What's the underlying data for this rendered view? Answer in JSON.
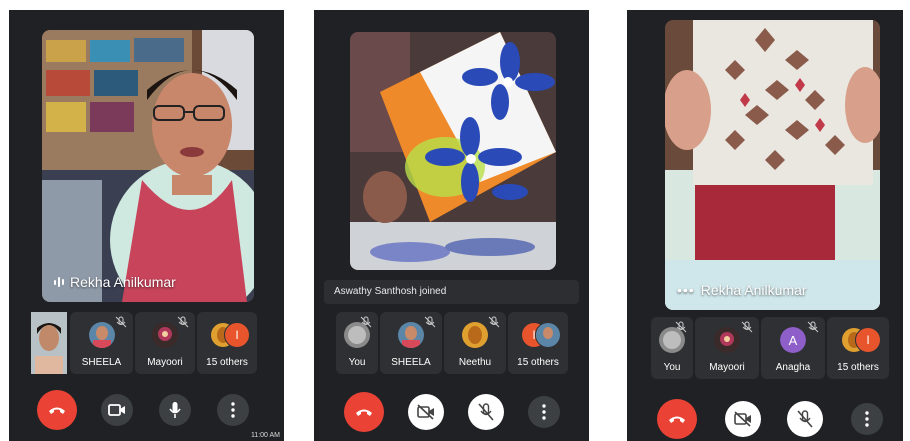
{
  "screens": [
    {
      "speaker_name": "Rekha Anilkumar",
      "tiles": [
        {
          "label": ""
        },
        {
          "label": "SHEELA"
        },
        {
          "label": "Mayoori"
        },
        {
          "label": "15 others",
          "badge": "I"
        }
      ],
      "status_time": "11:00 AM"
    },
    {
      "toast": "Aswathy Santhosh joined",
      "tiles": [
        {
          "label": "You"
        },
        {
          "label": "SHEELA"
        },
        {
          "label": "Neethu"
        },
        {
          "label": "15 others",
          "badge": "I"
        }
      ]
    },
    {
      "speaker_name": "Rekha Anilkumar",
      "tiles": [
        {
          "label": "You"
        },
        {
          "label": "Mayoori"
        },
        {
          "label": "Anagha",
          "avatar_letter": "A"
        },
        {
          "label": "15 others",
          "badge": "I"
        }
      ]
    }
  ],
  "colors": {
    "end_call": "#ea4335",
    "avatar_i": "#e8552d",
    "avatar_a": "#8e5fc9",
    "background": "#202124"
  }
}
